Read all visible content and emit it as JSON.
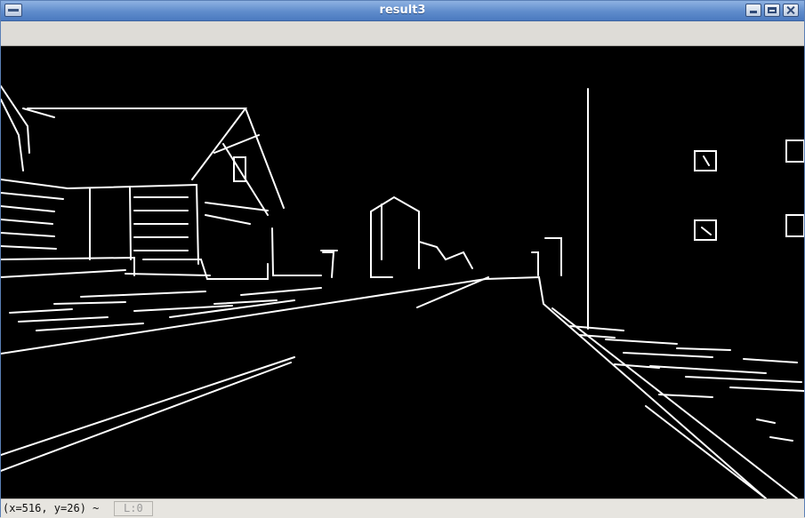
{
  "window": {
    "title": "result3"
  },
  "statusbar": {
    "coords": "(x=516, y=26) ~",
    "level": "L:0"
  },
  "colors": {
    "titlebar": "#5f8ccc",
    "canvas_background": "#000000",
    "edge_color": "#ffffff"
  },
  "icons": {
    "window_menu": "window-menu-icon",
    "minimize": "minimize-icon",
    "maximize": "maximize-icon",
    "close": "close-icon"
  }
}
